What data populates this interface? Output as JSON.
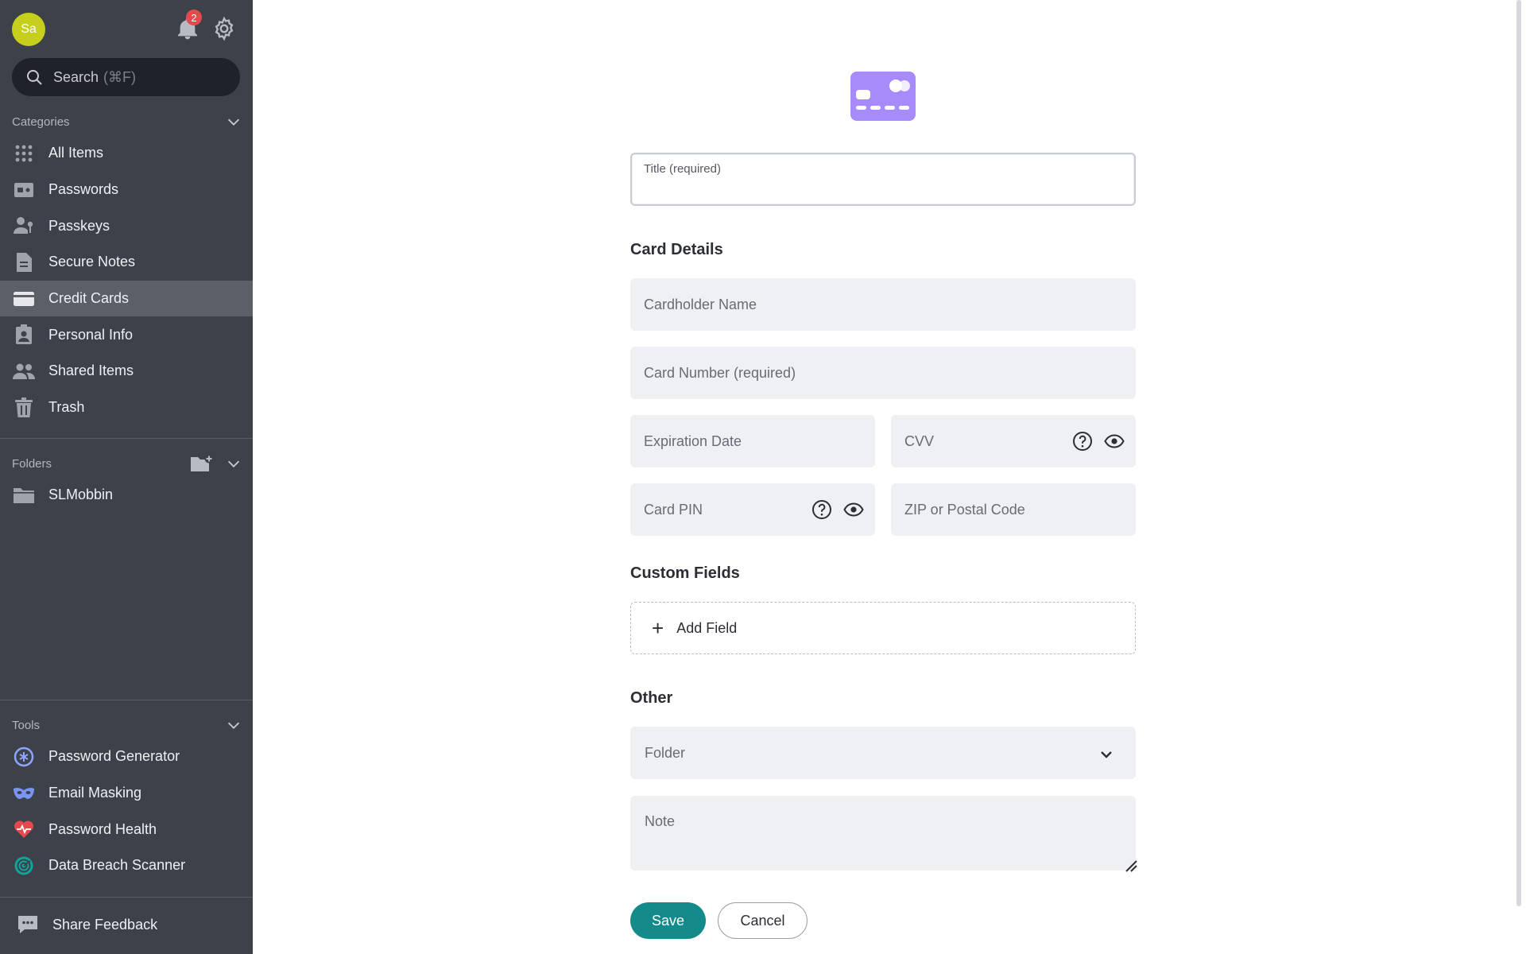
{
  "sidebar": {
    "avatar_initials": "Sa",
    "notification_count": "2",
    "search": {
      "label": "Search",
      "shortcut": "(⌘F)"
    },
    "categories_label": "Categories",
    "categories": [
      {
        "label": "All Items",
        "icon": "grid-icon"
      },
      {
        "label": "Passwords",
        "icon": "password-icon"
      },
      {
        "label": "Passkeys",
        "icon": "passkey-icon"
      },
      {
        "label": "Secure Notes",
        "icon": "note-icon"
      },
      {
        "label": "Credit Cards",
        "icon": "credit-card-icon"
      },
      {
        "label": "Personal Info",
        "icon": "personal-info-icon"
      },
      {
        "label": "Shared Items",
        "icon": "shared-items-icon"
      },
      {
        "label": "Trash",
        "icon": "trash-icon"
      }
    ],
    "active_category": "Credit Cards",
    "folders_label": "Folders",
    "folders": [
      {
        "label": "SLMobbin",
        "icon": "folder-icon"
      }
    ],
    "tools_label": "Tools",
    "tools": [
      {
        "label": "Password Generator",
        "icon": "password-generator-icon"
      },
      {
        "label": "Email Masking",
        "icon": "mask-icon"
      },
      {
        "label": "Password Health",
        "icon": "health-icon"
      },
      {
        "label": "Data Breach Scanner",
        "icon": "scanner-icon"
      }
    ],
    "feedback_label": "Share Feedback"
  },
  "form": {
    "title_placeholder": "Title (required)",
    "card_details_heading": "Card Details",
    "cardholder_placeholder": "Cardholder Name",
    "card_number_placeholder": "Card Number (required)",
    "expiration_placeholder": "Expiration Date",
    "cvv_placeholder": "CVV",
    "pin_placeholder": "Card PIN",
    "zip_placeholder": "ZIP or Postal Code",
    "custom_fields_heading": "Custom Fields",
    "add_field_label": "Add Field",
    "other_heading": "Other",
    "folder_placeholder": "Folder",
    "note_placeholder": "Note",
    "save_label": "Save",
    "cancel_label": "Cancel"
  },
  "colors": {
    "sidebar_bg": "#3d4149",
    "accent": "#148b8a",
    "card_icon": "#a78bfa",
    "badge": "#e5484d"
  }
}
